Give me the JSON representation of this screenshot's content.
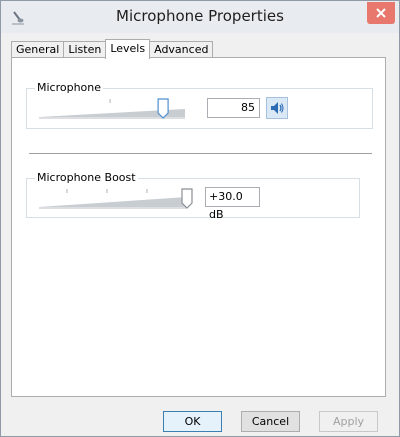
{
  "window": {
    "title": "Microphone Properties"
  },
  "tabs": [
    {
      "label": "General"
    },
    {
      "label": "Listen"
    },
    {
      "label": "Levels"
    },
    {
      "label": "Advanced"
    }
  ],
  "active_tab": "Levels",
  "microphone": {
    "label": "Microphone",
    "value": "85",
    "level": 85,
    "max": 100
  },
  "boost": {
    "label": "Microphone Boost",
    "value": "+30.0 dB",
    "level": 30,
    "max": 30
  },
  "buttons": {
    "ok": "OK",
    "cancel": "Cancel",
    "apply": "Apply"
  },
  "colors": {
    "close_button": "#e8776e",
    "slider_thumb": "#4f8ed0"
  }
}
